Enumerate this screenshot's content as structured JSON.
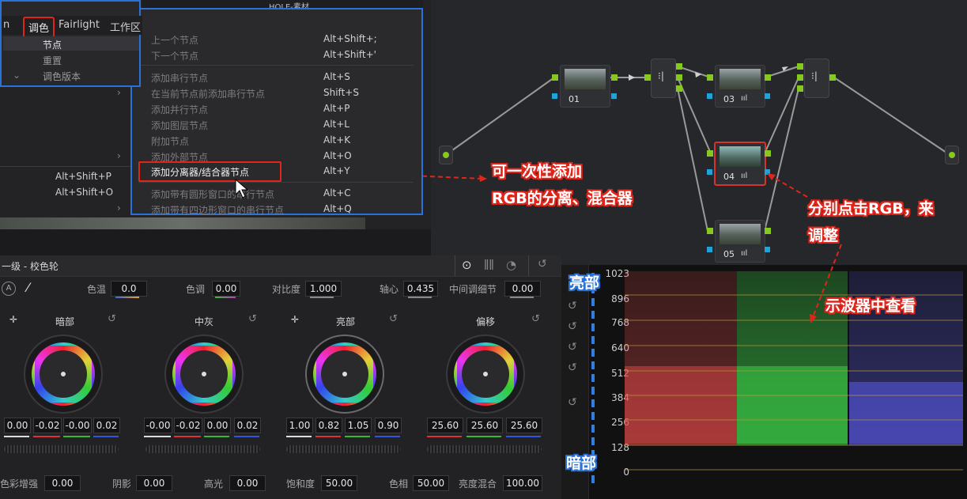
{
  "menubar": {
    "prev": "n",
    "color": "调色",
    "fairlight": "Fairlight",
    "workspace": "工作区"
  },
  "submenu": [
    "节点",
    "重置",
    "调色版本"
  ],
  "context_menu": [
    {
      "label": "上一个节点",
      "key": "Alt+Shift+;"
    },
    {
      "label": "下一个节点",
      "key": "Alt+Shift+'"
    },
    {
      "label": "添加串行节点",
      "key": "Alt+S"
    },
    {
      "label": "在当前节点前添加串行节点",
      "key": "Shift+S"
    },
    {
      "label": "添加并行节点",
      "key": "Alt+P"
    },
    {
      "label": "添加图层节点",
      "key": "Alt+L"
    },
    {
      "label": "附加节点",
      "key": "Alt+K"
    },
    {
      "label": "添加外部节点",
      "key": "Alt+O"
    },
    {
      "label": "添加分离器/结合器节点",
      "key": "Alt+Y"
    },
    {
      "label": "添加带有圆形窗口的串行节点",
      "key": "Alt+C"
    },
    {
      "label": "添加带有四边形窗口的串行节点",
      "key": "Alt+Q"
    }
  ],
  "left_shortcuts": [
    "Alt+Shift+P",
    "Alt+Shift+O"
  ],
  "title_strip": "HOLE-素材",
  "nodes": [
    "01",
    "03",
    "04",
    "05"
  ],
  "color_panel": {
    "title": "一级 - 校色轮",
    "params_top": [
      {
        "label": "色温",
        "value": "0.0"
      },
      {
        "label": "色调",
        "value": "0.00"
      },
      {
        "label": "对比度",
        "value": "1.000"
      },
      {
        "label": "轴心",
        "value": "0.435"
      },
      {
        "label": "中间调细节",
        "value": "0.00"
      }
    ],
    "wheels": [
      {
        "label": "暗部",
        "values": [
          "0.00",
          "-0.02",
          "-0.00",
          "0.02"
        ]
      },
      {
        "label": "中灰",
        "values": [
          "-0.00",
          "-0.02",
          "0.00",
          "0.02"
        ]
      },
      {
        "label": "亮部",
        "values": [
          "1.00",
          "0.82",
          "1.05",
          "0.90"
        ]
      },
      {
        "label": "偏移",
        "values": [
          "25.60",
          "25.60",
          "25.60"
        ]
      }
    ],
    "params_bottom": [
      {
        "label": "色彩增强",
        "value": "0.00"
      },
      {
        "label": "阴影",
        "value": "0.00"
      },
      {
        "label": "高光",
        "value": "0.00"
      },
      {
        "label": "饱和度",
        "value": "50.00"
      },
      {
        "label": "色相",
        "value": "50.00"
      },
      {
        "label": "亮度混合",
        "value": "100.00"
      }
    ]
  },
  "scope": {
    "ticks": [
      "1023",
      "896",
      "768",
      "640",
      "512",
      "384",
      "256",
      "128",
      "0"
    ],
    "top_label": "亮部",
    "bottom_label": "暗部"
  },
  "annotations": {
    "add_nodes": "可一次性添加",
    "add_nodes2": "RGB的分离、混合器",
    "click_rgb": "分别点击RGB，来",
    "click_rgb2": "调整",
    "view_scope": "示波器中查看"
  },
  "colors": {
    "accent_red": "#e0251b",
    "accent_blue": "#2b72d8",
    "port_green": "#86c81f",
    "port_blue": "#22a3d8"
  }
}
